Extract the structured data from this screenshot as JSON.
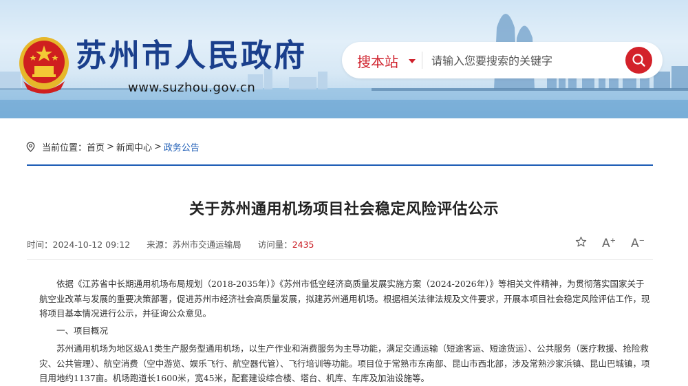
{
  "header": {
    "site_name": "苏州市人民政府",
    "site_url": "www.suzhou.gov.cn",
    "search": {
      "scope": "搜本站",
      "placeholder": "请输入您要搜索的关键字"
    },
    "colors": {
      "brand_blue": "#1a3f8c",
      "accent_red": "#d3222a"
    }
  },
  "breadcrumb": {
    "label": "当前位置：",
    "items": [
      "首页",
      "新闻中心",
      "政务公告"
    ],
    "separator": ">"
  },
  "article": {
    "title": "关于苏州通用机场项目社会稳定风险评估公示",
    "meta": {
      "time_label": "时间：",
      "time": "2024-10-12 09:12",
      "source_label": "来源：",
      "source": "苏州市交通运输局",
      "views_label": "访问量：",
      "views": "2435"
    },
    "tools": {
      "favorite_icon": "star-icon",
      "font_larger": "A",
      "font_smaller": "A",
      "plus": "+",
      "minus": "−"
    },
    "paragraphs": [
      "依据《江苏省中长期通用机场布局规划（2018-2035年）》《苏州市低空经济高质量发展实施方案（2024-2026年）》等相关文件精神，为贯彻落实国家关于航空业改革与发展的重要决策部署，促进苏州市经济社会高质量发展，拟建苏州通用机场。根据相关法律法规及文件要求，开展本项目社会稳定风险评估工作，现将项目基本情况进行公示，并征询公众意见。",
      "一、项目概况",
      "苏州通用机场为地区级A1类生产服务型通用机场，以生产作业和消费服务为主导功能，满足交通运输（短途客运、短途货运）、公共服务（医疗救援、抢险救灾、公共管理）、航空消费（空中游览、娱乐飞行、航空器代管）、飞行培训等功能。项目位于常熟市东南部、昆山市西北部，涉及常熟沙家浜镇、昆山巴城镇，项目用地约1137亩。机场跑道长1600米，宽45米，配套建设综合楼、塔台、机库、车库及加油设施等。"
    ]
  }
}
